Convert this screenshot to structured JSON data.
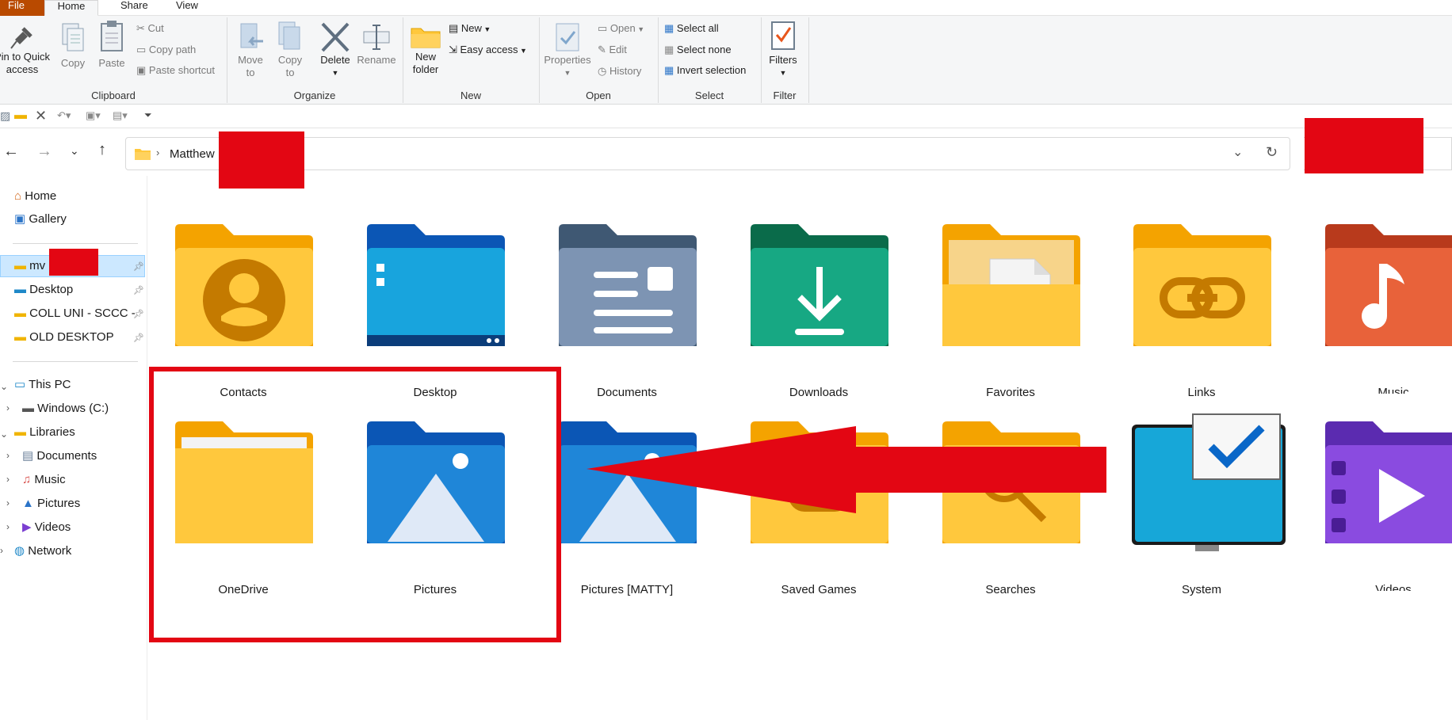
{
  "ribbon": {
    "tabs": [
      "File",
      "Home",
      "Share",
      "View"
    ],
    "clipboard": {
      "pin_label": "Pin to Quick access",
      "copy": "Copy",
      "paste": "Paste",
      "cut": "Cut",
      "copy_path": "Copy path",
      "paste_shortcut": "Paste shortcut",
      "group": "Clipboard"
    },
    "organize": {
      "move_to": "Move to",
      "copy_to": "Copy to",
      "delete": "Delete",
      "rename": "Rename",
      "group": "Organize"
    },
    "new": {
      "new_folder": "New folder",
      "new_item": "New",
      "easy_access": "Easy access",
      "group": "New"
    },
    "open": {
      "properties": "Properties",
      "open": "Open",
      "edit": "Edit",
      "history": "History",
      "group": "Open"
    },
    "select": {
      "select_all": "Select all",
      "select_none": "Select none",
      "invert": "Invert selection",
      "group": "Select"
    },
    "filter": {
      "filters": "Filters",
      "group": "Filter"
    }
  },
  "address": {
    "path": "Matthew"
  },
  "sidebar": {
    "home": "Home",
    "gallery": "Gallery",
    "quick": [
      {
        "label": "mv"
      },
      {
        "label": "Desktop"
      },
      {
        "label": "COLL UNI - SCCC -"
      },
      {
        "label": "OLD DESKTOP"
      }
    ],
    "this_pc": "This PC",
    "windows_c": "Windows (C:)",
    "libraries": "Libraries",
    "lib_items": [
      "Documents",
      "Music",
      "Pictures",
      "Videos"
    ],
    "network": "Network"
  },
  "folders": [
    {
      "label": "Contacts",
      "icon": "contacts-folder-icon"
    },
    {
      "label": "Desktop",
      "icon": "desktop-folder-icon"
    },
    {
      "label": "Documents",
      "icon": "documents-folder-icon"
    },
    {
      "label": "Downloads",
      "icon": "downloads-folder-icon"
    },
    {
      "label": "Favorites",
      "icon": "favorites-folder-icon"
    },
    {
      "label": "Links",
      "icon": "links-folder-icon"
    },
    {
      "label": "Music",
      "icon": "music-folder-icon"
    },
    {
      "label": "OneDrive",
      "icon": "onedrive-folder-icon"
    },
    {
      "label": "Pictures",
      "icon": "pictures-folder-icon"
    },
    {
      "label": "Pictures [MATTY]",
      "icon": "pictures-folder-icon"
    },
    {
      "label": "Saved Games",
      "icon": "saved-games-folder-icon"
    },
    {
      "label": "Searches",
      "icon": "searches-folder-icon"
    },
    {
      "label": "System",
      "icon": "system-monitor-icon"
    },
    {
      "label": "Videos",
      "icon": "videos-folder-icon"
    }
  ],
  "colors": {
    "annotation_red": "#e30613",
    "folder_yellow": "#ffc83d",
    "selection_blue": "#cce8ff"
  }
}
